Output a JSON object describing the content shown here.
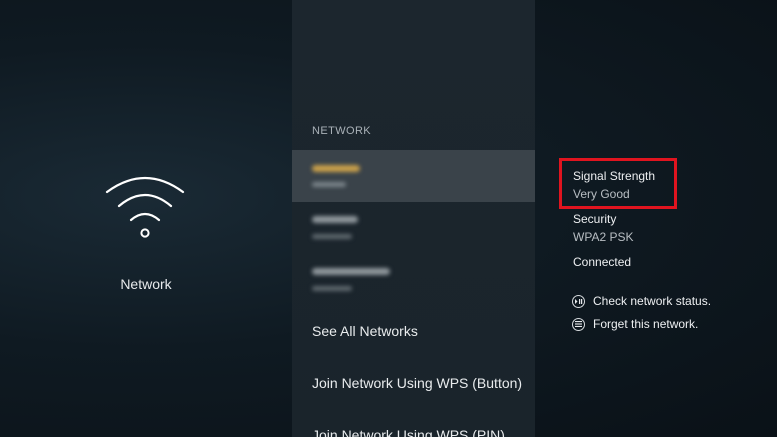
{
  "left": {
    "title": "Network",
    "icon": "wifi-icon"
  },
  "menu": {
    "header": "NETWORK",
    "saved_networks": [
      {
        "state": "selected",
        "name_color": "#c9a04a"
      },
      {
        "state": "normal",
        "name_color": "#8f979c"
      },
      {
        "state": "normal",
        "name_color": "#8f979c"
      }
    ],
    "see_all": "See All Networks",
    "wps_button": "Join Network Using WPS (Button)",
    "wps_pin": "Join Network Using WPS (PIN)"
  },
  "details": {
    "signal_label": "Signal Strength",
    "signal_value": "Very Good",
    "security_label": "Security",
    "security_value": "WPA2 PSK",
    "status": "Connected",
    "check_label": "Check network status.",
    "forget_label": "Forget this network.",
    "check_icon": "play-pause-button-icon",
    "forget_icon": "menu-button-icon"
  },
  "colors": {
    "highlight": "#e0141f",
    "selected_row": "#3a434a",
    "menu_bg": "#1c262e"
  }
}
